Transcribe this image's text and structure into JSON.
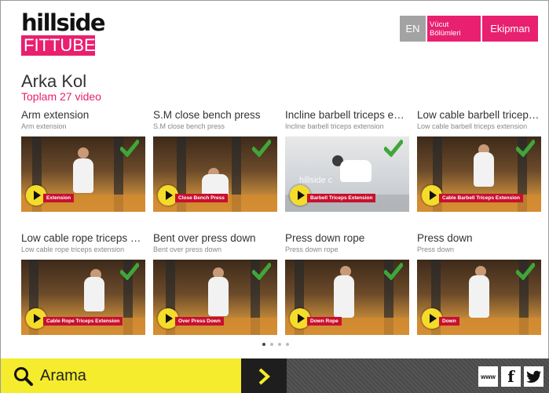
{
  "logo": {
    "top": "hillside",
    "bottom": "FITTUBE"
  },
  "header": {
    "lang_label": "EN",
    "body_parts_label": "Vücut Bölümleri",
    "equipment_label": "Ekipman"
  },
  "page": {
    "title": "Arka Kol",
    "subtitle": "Toplam 27 video"
  },
  "colors": {
    "brand_pink": "#e8206f",
    "search_yellow": "#f4ec2c",
    "check_green": "#3fa63a"
  },
  "videos": [
    {
      "title": "Arm extension",
      "subtitle": "Arm extension",
      "thumb_label": "Extension",
      "watermark": ""
    },
    {
      "title": "S.M close bench press",
      "subtitle": "S.M close bench press",
      "thumb_label": "Close Bench Press",
      "watermark": ""
    },
    {
      "title": "Incline barbell triceps extension",
      "subtitle": "Incline barbell triceps extension",
      "thumb_label": "Barbell Triceps Extension",
      "watermark": "hillside c"
    },
    {
      "title": "Low cable barbell triceps extension",
      "subtitle": "Low cable barbell triceps extension",
      "thumb_label": "Cable Barbell Triceps Extension",
      "watermark": ""
    },
    {
      "title": "Low cable rope triceps extension",
      "subtitle": "Low cable rope triceps extension",
      "thumb_label": "Cable Rope Triceps Extension",
      "watermark": ""
    },
    {
      "title": "Bent over press down",
      "subtitle": "Bent over press down",
      "thumb_label": "Over Press Down",
      "watermark": ""
    },
    {
      "title": "Press down rope",
      "subtitle": "Press down rope",
      "thumb_label": "Down Rope",
      "watermark": ""
    },
    {
      "title": "Press down",
      "subtitle": "Press down",
      "thumb_label": "Down",
      "watermark": ""
    }
  ],
  "pagination": {
    "pages": 4,
    "current": 1
  },
  "search": {
    "label": "Arama"
  },
  "social": {
    "www_label": "www",
    "facebook_label": "f"
  }
}
